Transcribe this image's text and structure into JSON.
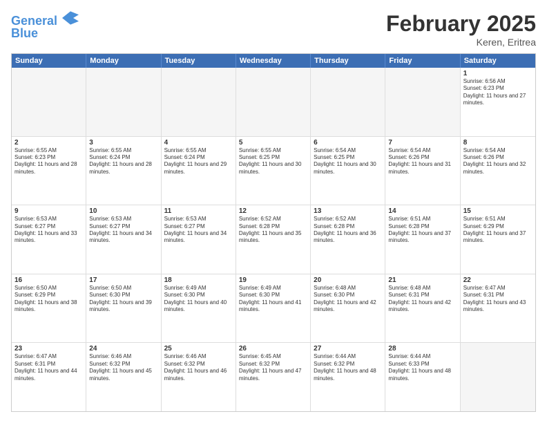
{
  "header": {
    "logo_line1": "General",
    "logo_line2": "Blue",
    "title": "February 2025",
    "subtitle": "Keren, Eritrea"
  },
  "weekdays": [
    "Sunday",
    "Monday",
    "Tuesday",
    "Wednesday",
    "Thursday",
    "Friday",
    "Saturday"
  ],
  "rows": [
    [
      {
        "day": "",
        "empty": true
      },
      {
        "day": "",
        "empty": true
      },
      {
        "day": "",
        "empty": true
      },
      {
        "day": "",
        "empty": true
      },
      {
        "day": "",
        "empty": true
      },
      {
        "day": "",
        "empty": true
      },
      {
        "day": "1",
        "sunrise": "6:56 AM",
        "sunset": "6:23 PM",
        "daylight": "11 hours and 27 minutes."
      }
    ],
    [
      {
        "day": "2",
        "sunrise": "6:55 AM",
        "sunset": "6:23 PM",
        "daylight": "11 hours and 28 minutes."
      },
      {
        "day": "3",
        "sunrise": "6:55 AM",
        "sunset": "6:24 PM",
        "daylight": "11 hours and 28 minutes."
      },
      {
        "day": "4",
        "sunrise": "6:55 AM",
        "sunset": "6:24 PM",
        "daylight": "11 hours and 29 minutes."
      },
      {
        "day": "5",
        "sunrise": "6:55 AM",
        "sunset": "6:25 PM",
        "daylight": "11 hours and 30 minutes."
      },
      {
        "day": "6",
        "sunrise": "6:54 AM",
        "sunset": "6:25 PM",
        "daylight": "11 hours and 30 minutes."
      },
      {
        "day": "7",
        "sunrise": "6:54 AM",
        "sunset": "6:26 PM",
        "daylight": "11 hours and 31 minutes."
      },
      {
        "day": "8",
        "sunrise": "6:54 AM",
        "sunset": "6:26 PM",
        "daylight": "11 hours and 32 minutes."
      }
    ],
    [
      {
        "day": "9",
        "sunrise": "6:53 AM",
        "sunset": "6:27 PM",
        "daylight": "11 hours and 33 minutes."
      },
      {
        "day": "10",
        "sunrise": "6:53 AM",
        "sunset": "6:27 PM",
        "daylight": "11 hours and 34 minutes."
      },
      {
        "day": "11",
        "sunrise": "6:53 AM",
        "sunset": "6:27 PM",
        "daylight": "11 hours and 34 minutes."
      },
      {
        "day": "12",
        "sunrise": "6:52 AM",
        "sunset": "6:28 PM",
        "daylight": "11 hours and 35 minutes."
      },
      {
        "day": "13",
        "sunrise": "6:52 AM",
        "sunset": "6:28 PM",
        "daylight": "11 hours and 36 minutes."
      },
      {
        "day": "14",
        "sunrise": "6:51 AM",
        "sunset": "6:28 PM",
        "daylight": "11 hours and 37 minutes."
      },
      {
        "day": "15",
        "sunrise": "6:51 AM",
        "sunset": "6:29 PM",
        "daylight": "11 hours and 37 minutes."
      }
    ],
    [
      {
        "day": "16",
        "sunrise": "6:50 AM",
        "sunset": "6:29 PM",
        "daylight": "11 hours and 38 minutes."
      },
      {
        "day": "17",
        "sunrise": "6:50 AM",
        "sunset": "6:30 PM",
        "daylight": "11 hours and 39 minutes."
      },
      {
        "day": "18",
        "sunrise": "6:49 AM",
        "sunset": "6:30 PM",
        "daylight": "11 hours and 40 minutes."
      },
      {
        "day": "19",
        "sunrise": "6:49 AM",
        "sunset": "6:30 PM",
        "daylight": "11 hours and 41 minutes."
      },
      {
        "day": "20",
        "sunrise": "6:48 AM",
        "sunset": "6:30 PM",
        "daylight": "11 hours and 42 minutes."
      },
      {
        "day": "21",
        "sunrise": "6:48 AM",
        "sunset": "6:31 PM",
        "daylight": "11 hours and 42 minutes."
      },
      {
        "day": "22",
        "sunrise": "6:47 AM",
        "sunset": "6:31 PM",
        "daylight": "11 hours and 43 minutes."
      }
    ],
    [
      {
        "day": "23",
        "sunrise": "6:47 AM",
        "sunset": "6:31 PM",
        "daylight": "11 hours and 44 minutes."
      },
      {
        "day": "24",
        "sunrise": "6:46 AM",
        "sunset": "6:32 PM",
        "daylight": "11 hours and 45 minutes."
      },
      {
        "day": "25",
        "sunrise": "6:46 AM",
        "sunset": "6:32 PM",
        "daylight": "11 hours and 46 minutes."
      },
      {
        "day": "26",
        "sunrise": "6:45 AM",
        "sunset": "6:32 PM",
        "daylight": "11 hours and 47 minutes."
      },
      {
        "day": "27",
        "sunrise": "6:44 AM",
        "sunset": "6:32 PM",
        "daylight": "11 hours and 48 minutes."
      },
      {
        "day": "28",
        "sunrise": "6:44 AM",
        "sunset": "6:33 PM",
        "daylight": "11 hours and 48 minutes."
      },
      {
        "day": "",
        "empty": true
      }
    ]
  ]
}
